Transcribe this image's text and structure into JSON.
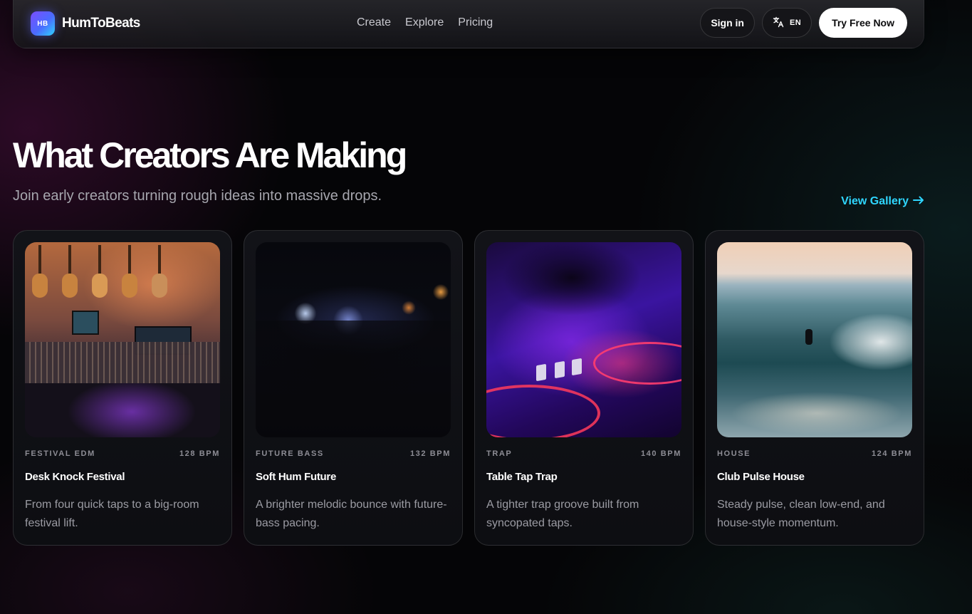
{
  "nav": {
    "logo_text": "HB",
    "brand": "HumToBeats",
    "links": [
      "Create",
      "Explore",
      "Pricing"
    ],
    "sign_in": "Sign in",
    "language_icon": "translate-icon",
    "language": "EN",
    "cta": "Try Free Now"
  },
  "hero": {
    "title": "What Creators Are Making",
    "subtitle": "Join early creators turning rough ideas into massive drops.",
    "view_gallery": "View Gallery",
    "view_gallery_icon": "arrow-right-icon",
    "accent_color": "#2fd6ff"
  },
  "cards": [
    {
      "genre": "FESTIVAL EDM",
      "bpm": "128 BPM",
      "title": "Desk Knock Festival",
      "description": "From four quick taps to a big-room festival lift.",
      "image": "music-studio-with-guitars"
    },
    {
      "genre": "FUTURE BASS",
      "bpm": "132 BPM",
      "title": "Soft Hum Future",
      "description": "A brighter melodic bounce with future-bass pacing.",
      "image": "concert-crowd-lights"
    },
    {
      "genre": "TRAP",
      "bpm": "140 BPM",
      "title": "Table Tap Trap",
      "description": "A tighter trap groove built from syncopated taps.",
      "image": "dj-mixer-purple"
    },
    {
      "genre": "HOUSE",
      "bpm": "124 BPM",
      "title": "Club Pulse House",
      "description": "Steady pulse, clean low-end, and house-style momentum.",
      "image": "surfer-on-wave"
    }
  ]
}
